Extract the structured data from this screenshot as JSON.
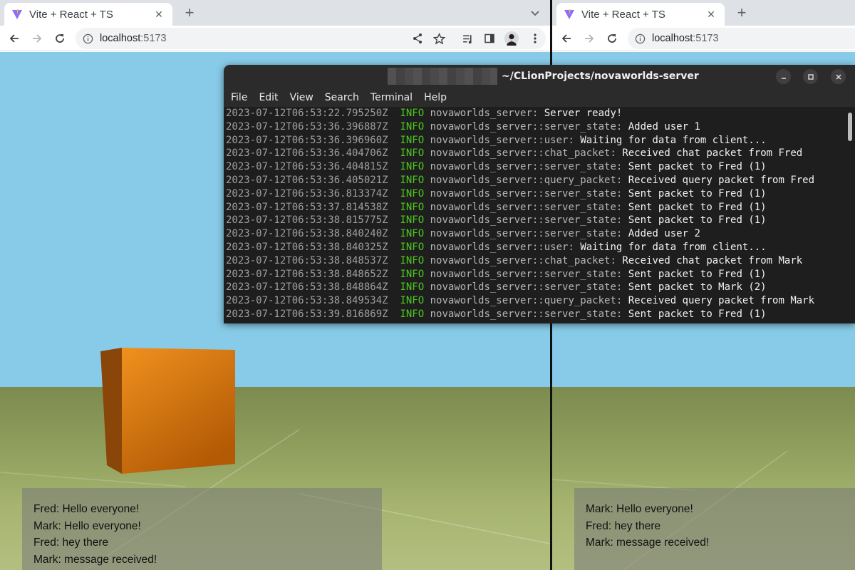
{
  "left_window": {
    "tab_title": "Vite + React + TS",
    "url_host": "localhost",
    "url_port": ":5173",
    "chat": [
      "Fred: Hello everyone!",
      "Mark: Hello everyone!",
      "Fred: hey there",
      "Mark: message received!"
    ]
  },
  "right_window": {
    "tab_title": "Vite + React + TS",
    "url_host": "localhost",
    "url_port": ":5173",
    "chat": [
      "Mark: Hello everyone!",
      "Fred: hey there",
      "Mark: message received!"
    ]
  },
  "terminal": {
    "title": "~/CLionProjects/novaworlds-server",
    "menu": [
      "File",
      "Edit",
      "View",
      "Search",
      "Terminal",
      "Help"
    ],
    "lines": [
      {
        "ts": "2023-07-12T06:53:22.795250Z",
        "level": "INFO",
        "module": "novaworlds_server:",
        "msg": "Server ready!"
      },
      {
        "ts": "2023-07-12T06:53:36.396887Z",
        "level": "INFO",
        "module": "novaworlds_server::server_state:",
        "msg": "Added user 1"
      },
      {
        "ts": "2023-07-12T06:53:36.396960Z",
        "level": "INFO",
        "module": "novaworlds_server::user:",
        "msg": "Waiting for data from client..."
      },
      {
        "ts": "2023-07-12T06:53:36.404706Z",
        "level": "INFO",
        "module": "novaworlds_server::chat_packet:",
        "msg": "Received chat packet from Fred"
      },
      {
        "ts": "2023-07-12T06:53:36.404815Z",
        "level": "INFO",
        "module": "novaworlds_server::server_state:",
        "msg": "Sent packet to Fred (1)"
      },
      {
        "ts": "2023-07-12T06:53:36.405021Z",
        "level": "INFO",
        "module": "novaworlds_server::query_packet:",
        "msg": "Received query packet from Fred"
      },
      {
        "ts": "2023-07-12T06:53:36.813374Z",
        "level": "INFO",
        "module": "novaworlds_server::server_state:",
        "msg": "Sent packet to Fred (1)"
      },
      {
        "ts": "2023-07-12T06:53:37.814538Z",
        "level": "INFO",
        "module": "novaworlds_server::server_state:",
        "msg": "Sent packet to Fred (1)"
      },
      {
        "ts": "2023-07-12T06:53:38.815775Z",
        "level": "INFO",
        "module": "novaworlds_server::server_state:",
        "msg": "Sent packet to Fred (1)"
      },
      {
        "ts": "2023-07-12T06:53:38.840240Z",
        "level": "INFO",
        "module": "novaworlds_server::server_state:",
        "msg": "Added user 2"
      },
      {
        "ts": "2023-07-12T06:53:38.840325Z",
        "level": "INFO",
        "module": "novaworlds_server::user:",
        "msg": "Waiting for data from client..."
      },
      {
        "ts": "2023-07-12T06:53:38.848537Z",
        "level": "INFO",
        "module": "novaworlds_server::chat_packet:",
        "msg": "Received chat packet from Mark"
      },
      {
        "ts": "2023-07-12T06:53:38.848652Z",
        "level": "INFO",
        "module": "novaworlds_server::server_state:",
        "msg": "Sent packet to Fred (1)"
      },
      {
        "ts": "2023-07-12T06:53:38.848864Z",
        "level": "INFO",
        "module": "novaworlds_server::server_state:",
        "msg": "Sent packet to Mark (2)"
      },
      {
        "ts": "2023-07-12T06:53:38.849534Z",
        "level": "INFO",
        "module": "novaworlds_server::query_packet:",
        "msg": "Received query packet from Mark"
      },
      {
        "ts": "2023-07-12T06:53:39.816869Z",
        "level": "INFO",
        "module": "novaworlds_server::server_state:",
        "msg": "Sent packet to Fred (1)"
      }
    ]
  },
  "colors": {
    "cube": "#d9790e",
    "sky": "#87cbe8",
    "ground": "#8e9c5c",
    "log_level": "#4ec91e"
  },
  "icons": [
    "vite-icon",
    "close-icon",
    "plus-icon",
    "chevron-down-icon",
    "back-arrow-icon",
    "forward-arrow-icon",
    "reload-icon",
    "info-icon",
    "share-icon",
    "star-icon",
    "media-icon",
    "side-panel-icon",
    "profile-avatar",
    "kebab-menu-icon",
    "minimize-icon",
    "maximize-icon"
  ]
}
